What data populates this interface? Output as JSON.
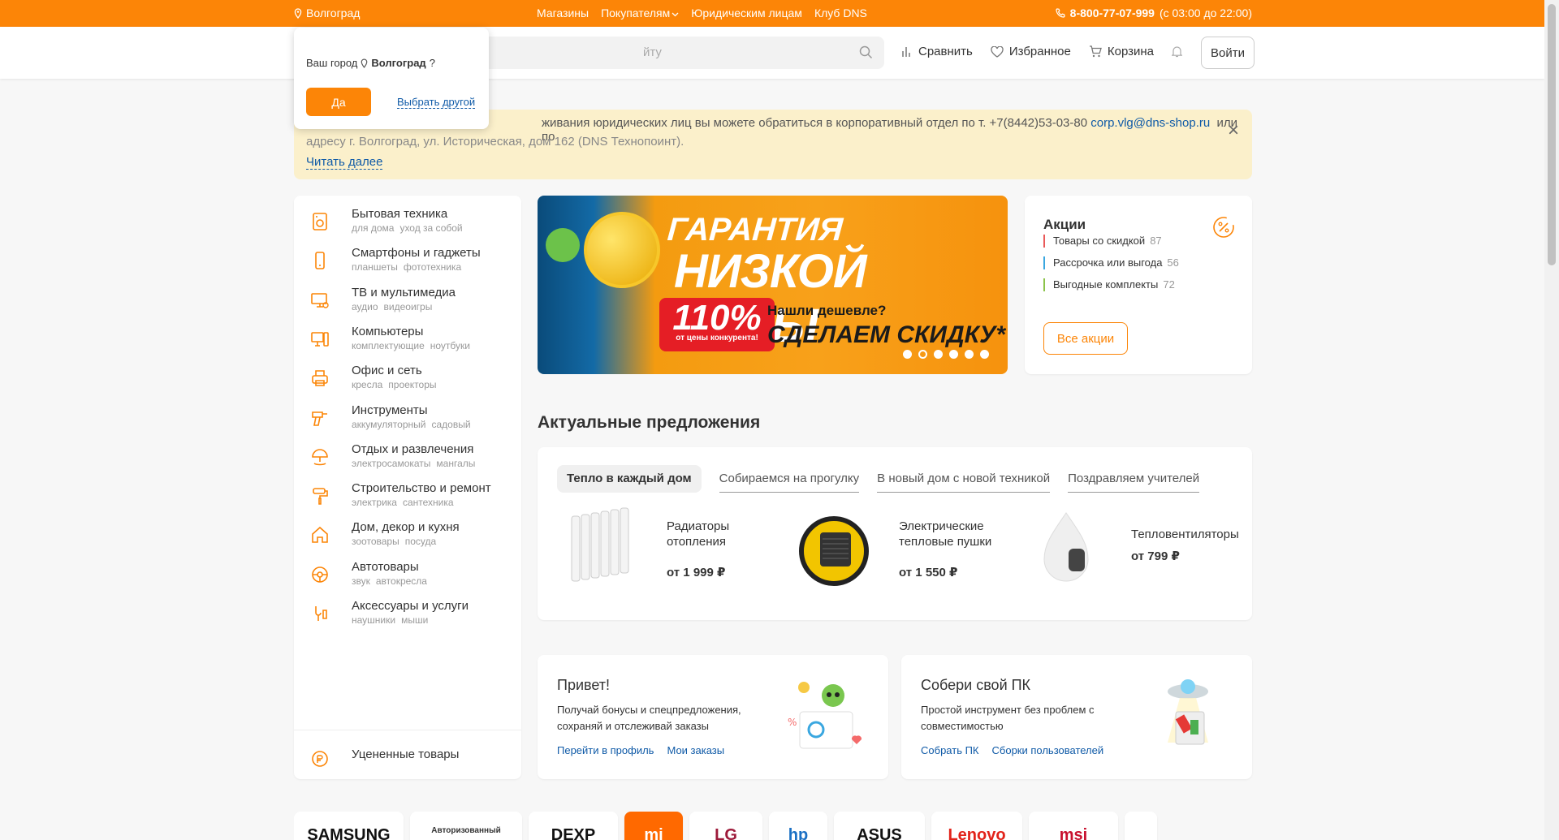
{
  "topbar": {
    "city": "Волгоград",
    "links": [
      "Магазины",
      "Покупателям",
      "Юридическим лицам",
      "Клуб DNS"
    ],
    "phone": "8-800-77-07-999",
    "hours": "(с 03:00 до 22:00)"
  },
  "header": {
    "search_placeholder": "Поиск по сайту",
    "search_visible": "йту",
    "compare": "Сравнить",
    "favorites": "Избранное",
    "cart": "Корзина",
    "login": "Войти"
  },
  "citypop": {
    "question": "Ваш город",
    "city": "Волгоград",
    "q_mark": "?",
    "yes": "Да",
    "other": "Выбрать другой"
  },
  "notice": {
    "line1": "живания юридических лиц вы можете обратиться в корпоративный отдел по т. +7(8442)53-03-80",
    "email": "corp.vlg@dns-shop.ru",
    "line1_end": "или по",
    "line2": "адресу г. Волгоград, ул. Историческая, дом 162 (DNS Технопоинт).",
    "more": "Читать далее",
    "close": "×"
  },
  "catalog": [
    {
      "name": "Бытовая техника",
      "subs": [
        "для дома",
        "уход за собой"
      ],
      "icon": "appliance-icon"
    },
    {
      "name": "Смартфоны и гаджеты",
      "subs": [
        "планшеты",
        "фототехника"
      ],
      "icon": "smartphone-icon"
    },
    {
      "name": "ТВ и мультимедиа",
      "subs": [
        "аудио",
        "видеоигры"
      ],
      "icon": "tv-icon"
    },
    {
      "name": "Компьютеры",
      "subs": [
        "комплектующие",
        "ноутбуки"
      ],
      "icon": "computer-icon"
    },
    {
      "name": "Офис и сеть",
      "subs": [
        "кресла",
        "проекторы"
      ],
      "icon": "printer-icon"
    },
    {
      "name": "Инструменты",
      "subs": [
        "аккумуляторный",
        "садовый"
      ],
      "icon": "drill-icon"
    },
    {
      "name": "Отдых и развлечения",
      "subs": [
        "электросамокаты",
        "мангалы"
      ],
      "icon": "umbrella-icon"
    },
    {
      "name": "Строительство и ремонт",
      "subs": [
        "электрика",
        "сантехника"
      ],
      "icon": "roller-icon"
    },
    {
      "name": "Дом, декор и кухня",
      "subs": [
        "зоотовары",
        "посуда"
      ],
      "icon": "house-icon"
    },
    {
      "name": "Автотовары",
      "subs": [
        "звук",
        "автокресла"
      ],
      "icon": "wheel-icon"
    },
    {
      "name": "Аксессуары и услуги",
      "subs": [
        "наушники",
        "мыши"
      ],
      "icon": "accessories-icon"
    }
  ],
  "catalog_extra": {
    "name": "Уцененные товары",
    "icon": "discount-icon"
  },
  "banner": {
    "line1": "ГАРАНТИЯ",
    "line2": "НИЗКОЙ ЦЕНЫ",
    "pct": "110%",
    "pct_sub": "от цены конкурента!",
    "q": "Нашли дешевле?",
    "deal": "СДЕЛАЕМ СКИДКУ*",
    "active_slide": 2,
    "slides": 6
  },
  "promo": {
    "title": "Акции",
    "items": [
      {
        "label": "Товары со скидкой",
        "count": "87",
        "color": "#e95a5a"
      },
      {
        "label": "Рассрочка или выгода",
        "count": "56",
        "color": "#3aa7e0"
      },
      {
        "label": "Выгодные комплекты",
        "count": "72",
        "color": "#8bc34a"
      }
    ],
    "all": "Все акции"
  },
  "offers": {
    "title": "Актуальные предложения",
    "tabs": [
      "Тепло в каждый дом",
      "Собираемся на прогулку",
      "В новый дом с новой техникой",
      "Поздравляем учителей"
    ],
    "products": [
      {
        "name": "Радиаторы отопления",
        "price": "от 1 999 ₽"
      },
      {
        "name": "Электрические тепловые пушки",
        "price": "от 1 550 ₽"
      },
      {
        "name": "Тепловентиляторы",
        "price": "от 799 ₽"
      }
    ]
  },
  "cards": [
    {
      "title": "Привет!",
      "text": "Получай бонусы и спецпредложения, сохраняй и отслеживай заказы",
      "links": [
        "Перейти в профиль",
        "Мои заказы"
      ]
    },
    {
      "title": "Собери свой ПК",
      "text": "Простой инструмент без проблем с совместимостью",
      "links": [
        "Собрать ПК",
        "Сборки пользователей"
      ]
    }
  ],
  "brands": [
    "SAMSUNG",
    "Авторизованный",
    "DEXP",
    "mi",
    "LG",
    "hp",
    "ASUS",
    "Lenovo",
    "msi",
    ""
  ]
}
